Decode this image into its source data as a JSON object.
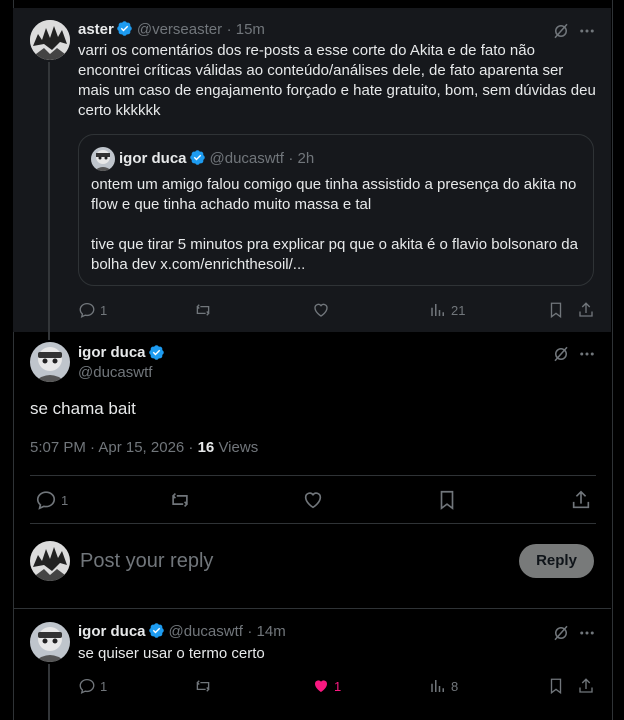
{
  "parent_post": {
    "author": "aster",
    "handle": "@verseaster",
    "time": "· 15m",
    "text": "varri os comentários dos re-posts a esse corte do Akita e de fato não encontrei críticas válidas ao conteúdo/análises dele, de fato aparenta ser mais um caso de engajamento forçado e hate gratuito, bom, sem dúvidas deu certo kkkkkk",
    "quote": {
      "author": "igor duca",
      "handle": "@ducaswtf",
      "time": "· 2h",
      "text_p1": "ontem um amigo falou comigo que tinha assistido a presença do akita no flow e que tinha achado muito massa e tal",
      "text_p2": "tive que tirar 5 minutos pra explicar pq que o akita é o flavio bolsonaro da bolha dev x.com/enrichthesoil/..."
    },
    "replies": "1",
    "views": "21"
  },
  "main_post": {
    "author": "igor duca",
    "handle": "@ducaswtf",
    "text": "se chama bait",
    "meta_time": "5:07 PM · Apr 15, 2026 · ",
    "views_count": "16",
    "views_label": " Views",
    "replies": "1"
  },
  "reply_box": {
    "placeholder": "Post your reply",
    "button_label": "Reply"
  },
  "reply_post": {
    "author": "igor duca",
    "handle": "@ducaswtf",
    "time": "· 14m",
    "text": "se quiser usar o termo certo",
    "replies": "1",
    "likes": "1",
    "views": "8"
  },
  "colors": {
    "background": "#000000",
    "parent_bg": "#16181c",
    "text": "#e7e9ea",
    "muted": "#71767b",
    "verified": "#1d9bf0",
    "like": "#f91880",
    "reply_button_bg": "#787a7a"
  }
}
